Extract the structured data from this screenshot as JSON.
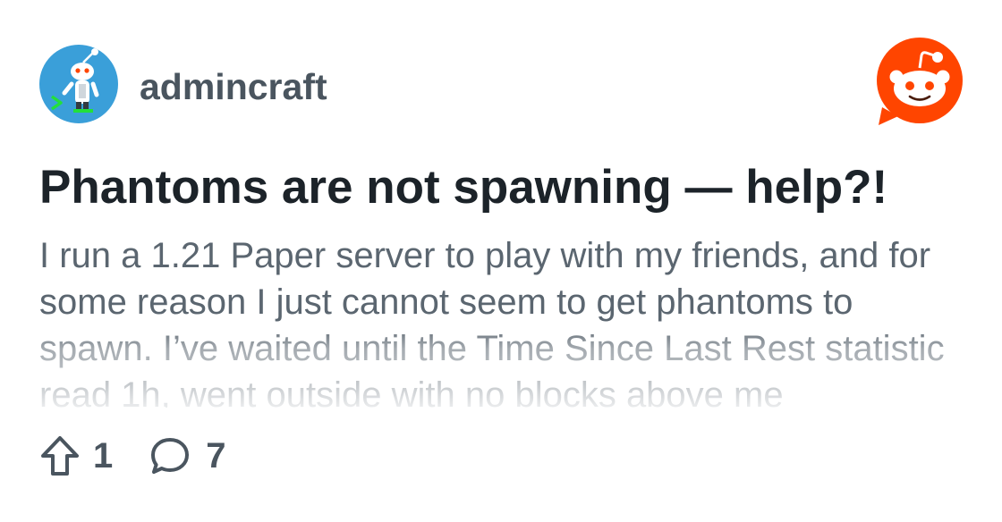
{
  "header": {
    "subreddit_name": "admincraft",
    "subreddit_avatar_icon": "admincraft-snoo-terminal-icon",
    "brand_logo_icon": "reddit-logo-icon"
  },
  "post": {
    "title": "Phantoms are not spawning — help?!",
    "body": "I run a 1.21 Paper server to play with my friends, and for some reason I just cannot seem to get phantoms to spawn. I’ve waited until the Time Since Last Rest statistic read 1h, went outside with no blocks above me"
  },
  "footer": {
    "upvote_icon": "upvote-arrow-icon",
    "upvote_count": "1",
    "comment_icon": "comment-bubble-icon",
    "comment_count": "7"
  },
  "colors": {
    "brand_orange": "#ff4500",
    "avatar_blue": "#3a9fd9",
    "title_text": "#1c2329",
    "meta_text": "#4a555f",
    "body_text": "#5b6670",
    "terminal_green": "#22e03a"
  }
}
